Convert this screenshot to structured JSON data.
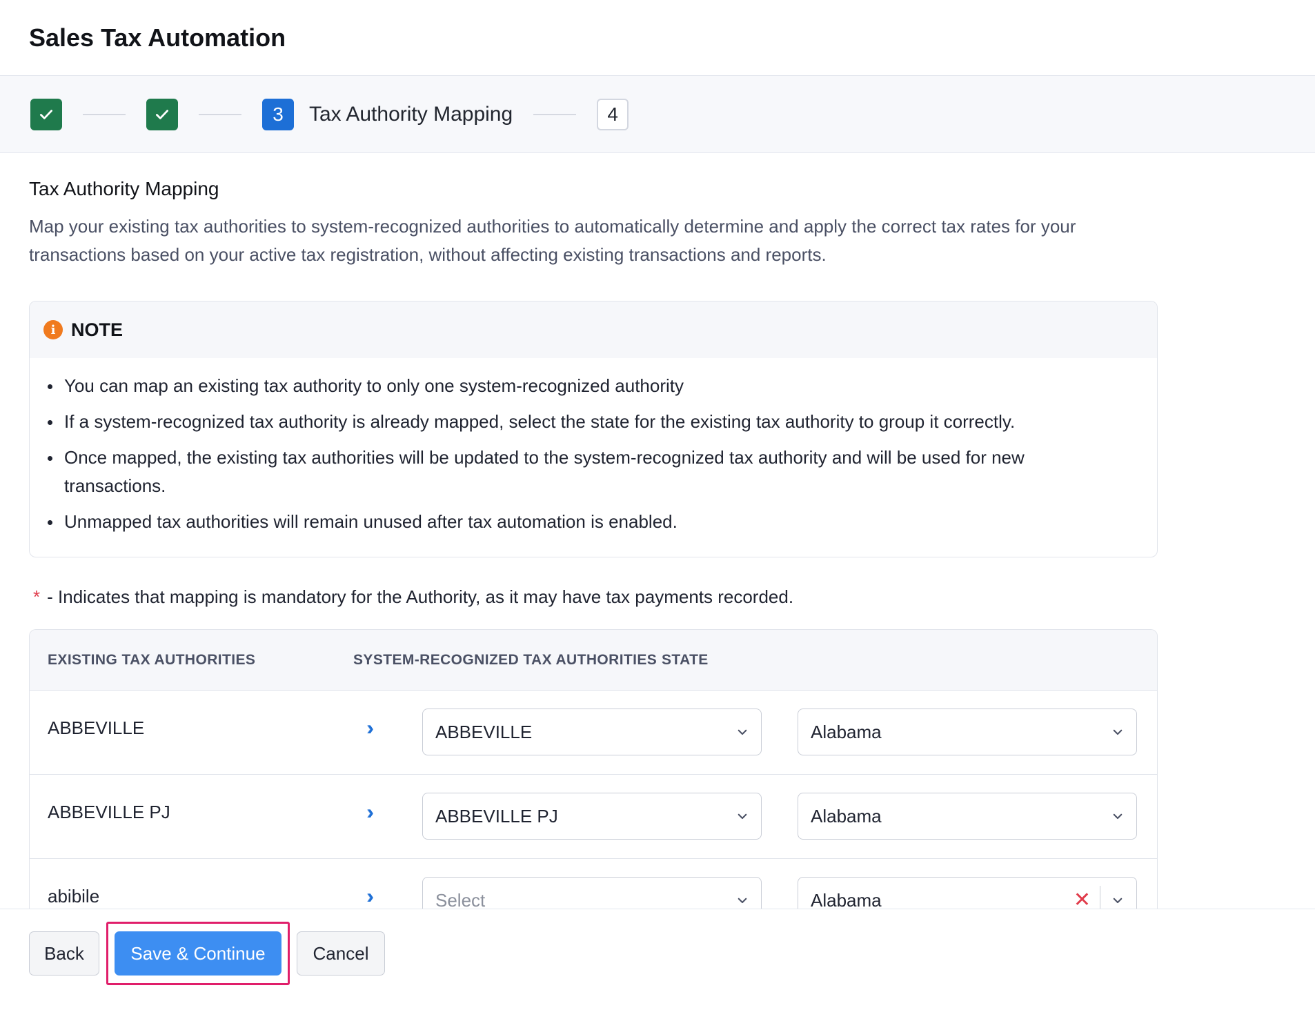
{
  "header": {
    "title": "Sales Tax Automation"
  },
  "stepper": {
    "steps": [
      {
        "status": "done",
        "icon": "check-icon"
      },
      {
        "status": "done",
        "icon": "check-icon"
      },
      {
        "status": "active",
        "number": "3",
        "label": "Tax Authority Mapping"
      },
      {
        "status": "todo",
        "number": "4"
      }
    ]
  },
  "section": {
    "title": "Tax Authority Mapping",
    "description": "Map your existing tax authorities to system-recognized authorities to automatically determine and apply the correct tax rates for your transactions based on your active tax registration, without affecting existing transactions and reports."
  },
  "note": {
    "title": "NOTE",
    "icon": "info-icon",
    "items": [
      "You can map an existing tax authority to only one system-recognized authority",
      "If a system-recognized tax authority is already mapped, select the state for the existing tax authority to group it correctly.",
      "Once mapped, the existing tax authorities will be updated to the system-recognized tax authority and will be used for new transactions.",
      "Unmapped tax authorities will remain unused after tax automation is enabled."
    ]
  },
  "mandatory": {
    "star": "*",
    "text": "- Indicates that mapping is mandatory for the Authority, as it may have tax payments recorded."
  },
  "table": {
    "headers": [
      "EXISTING TAX AUTHORITIES",
      "SYSTEM-RECOGNIZED TAX AUTHORITIES",
      "STATE"
    ],
    "rows": [
      {
        "existing": "ABBEVILLE",
        "system": "ABBEVILLE",
        "state": "Alabama"
      },
      {
        "existing": "ABBEVILLE PJ",
        "system": "ABBEVILLE PJ",
        "state": "Alabama"
      },
      {
        "existing": "abibile",
        "system": "",
        "system_placeholder": "Select",
        "state": "Alabama"
      }
    ]
  },
  "footer": {
    "back_label": "Back",
    "save_label": "Save & Continue",
    "cancel_label": "Cancel"
  },
  "colors": {
    "step_done": "#1f7a4c",
    "step_active": "#1d6fd6",
    "primary_button": "#3d8ef2",
    "focus_ring": "#e01e6a",
    "info_icon": "#f07a1e",
    "required_star": "#e03a4a"
  }
}
